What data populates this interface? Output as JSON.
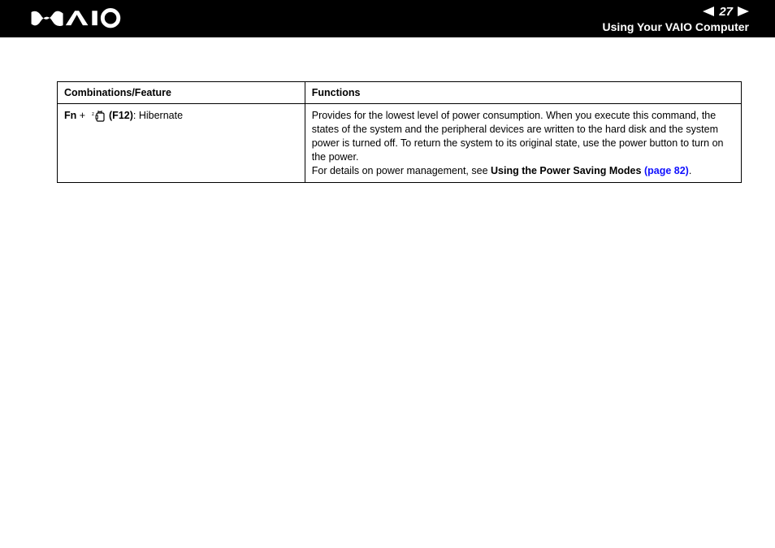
{
  "header": {
    "page_number": "27",
    "section_title": "Using Your VAIO Computer"
  },
  "table": {
    "headers": {
      "combinations": "Combinations/Feature",
      "functions": "Functions"
    },
    "row": {
      "fn_label": "Fn",
      "plus": " + ",
      "key_label": "(F12)",
      "feature_suffix": ": Hibernate",
      "description": "Provides for the lowest level of power consumption. When you execute this command, the states of the system and the peripheral devices are written to the hard disk and the system power is turned off. To return the system to its original state, use the power button to turn on the power.",
      "details_prefix": "For details on power management, see ",
      "details_link_bold": "Using the Power Saving Modes ",
      "details_page_link": "(page 82)",
      "details_period": "."
    }
  }
}
